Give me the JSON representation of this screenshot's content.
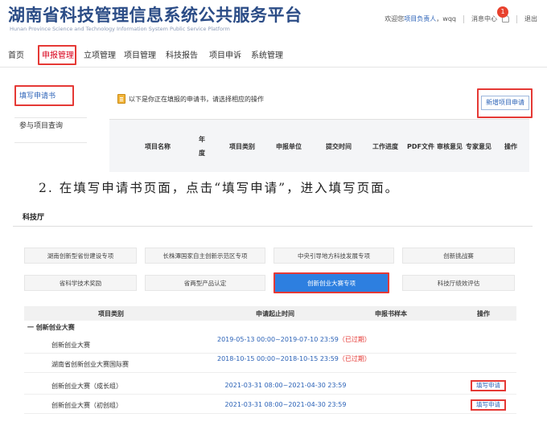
{
  "header": {
    "title": "湖南省科技管理信息系统公共服务平台",
    "subtitle": "Hunan Province Science and Technology Information System Public Service Platform",
    "welcome_prefix": "欢迎您",
    "user_role": "项目负责人",
    "username": "，wqq",
    "messages_label": "消息中心",
    "messages_count": "1",
    "logout_label": "退出"
  },
  "nav": {
    "items": [
      {
        "label": "首页"
      },
      {
        "label": "申报管理"
      },
      {
        "label": "立项管理"
      },
      {
        "label": "项目管理"
      },
      {
        "label": "科技报告"
      },
      {
        "label": "项目申诉"
      },
      {
        "label": "系统管理"
      }
    ]
  },
  "sidebar": {
    "items": [
      {
        "label": "填写申请书"
      },
      {
        "label": "参与项目查询"
      }
    ]
  },
  "application_panel": {
    "info": "以下是你正在填报的申请书，请选择相应的操作",
    "new_button": "新增项目申请",
    "columns": [
      "项目名称",
      "年度",
      "项目类别",
      "申报单位",
      "提交时间",
      "工作进度",
      "PDF文件",
      "审核意见",
      "专家意见",
      "操作"
    ]
  },
  "instruction": "2. 在填写申请书页面，点击“填写申请”，进入填写页面。",
  "bureau": {
    "title": "科技厅",
    "categories": [
      {
        "label": "湖南创新型省份建设专项"
      },
      {
        "label": "长株潭国家自主创新示范区专项"
      },
      {
        "label": "中央引导地方科技发展专项"
      },
      {
        "label": "创新挑战赛"
      },
      {
        "label": "省科学技术奖励"
      },
      {
        "label": "省两型产品认定"
      },
      {
        "label": "创新创业大赛专项"
      },
      {
        "label": "科技厅绩效评估"
      }
    ],
    "selected_category": "创新创业大赛专项",
    "table": {
      "headers": {
        "category": "项目类别",
        "period": "申请起止时间",
        "sample": "申报书样本",
        "action": "操作"
      },
      "group": "一 创新创业大赛",
      "rows": [
        {
          "name": "创新创业大赛",
          "period": "2019-05-13 00:00~2019-07-10 23:59",
          "status": "（已过期）",
          "action": ""
        },
        {
          "name": "湖南省创新创业大赛国际赛",
          "period": "2018-10-15 00:00~2018-10-15 23:59",
          "status": "（已过期）",
          "action": ""
        },
        {
          "name": "创新创业大赛（成长组）",
          "period": "2021-03-31 08:00~2021-04-30 23:59",
          "status": "",
          "action": "填写申请"
        },
        {
          "name": "创新创业大赛（初创组）",
          "period": "2021-03-31 08:00~2021-04-30 23:59",
          "status": "",
          "action": "填写申请"
        }
      ]
    }
  },
  "colors": {
    "brand_blue": "#2b4c86",
    "link_blue": "#2b62b7",
    "highlight_red": "#e53935",
    "selected_blue": "#2d7fe0"
  }
}
